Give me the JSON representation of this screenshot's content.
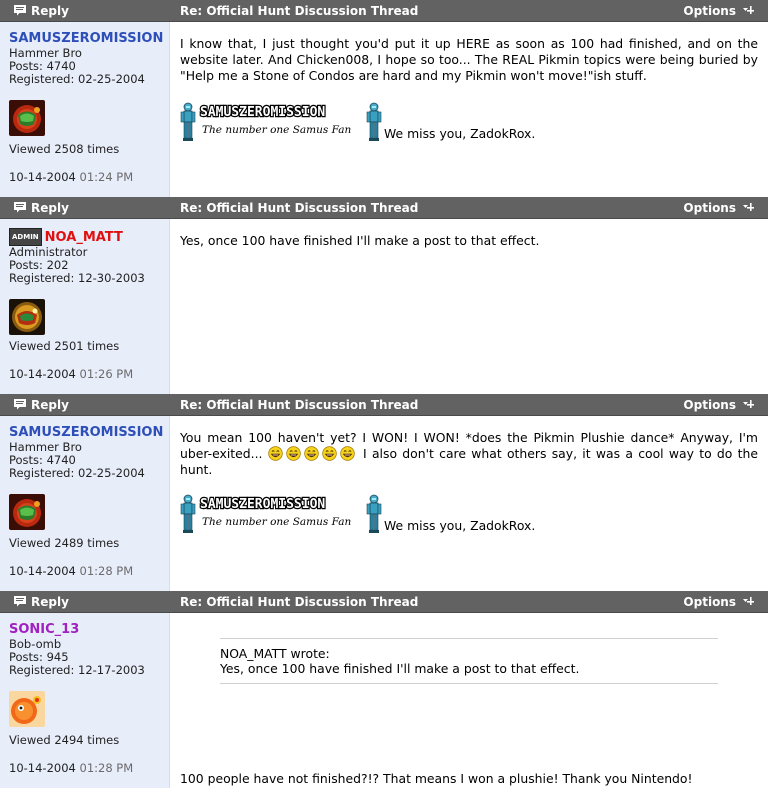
{
  "colors": {
    "bar_bg": "#626262",
    "user_bg": "#e8edfa",
    "username": "#2e4fb8",
    "admin_name": "#e01010",
    "sonic_name": "#a020c0",
    "time": "#6b6b6b"
  },
  "icons": {
    "reply": "reply-icon",
    "options": "options-icon",
    "smiley": "laughing-smiley-icon"
  },
  "posts": [
    {
      "reply_label": "Reply",
      "title": "Re: Official Hunt Discussion Thread",
      "options_label": "Options",
      "user": {
        "name": "SAMUSZEROMISSION",
        "rank": "Hammer Bro",
        "posts": "Posts: 4740",
        "registered": "Registered: 02-25-2004",
        "viewed": "Viewed 2508 times"
      },
      "date": "10-14-2004",
      "time": "01:24 PM",
      "body": "I know that, I just thought you'd put it up HERE as soon as 100 had finished, and on the website later. And Chicken008, I hope so too... The REAL Pikmin topics were being buried by \"Help me a Stone of Condos are hard and my Pikmin won't move!\"ish stuff.",
      "signature_banner": "SAMUSZEROMISSION",
      "signature_tagline": "The number one Samus Fan",
      "signature_text": "We miss you, ZadokRox."
    },
    {
      "reply_label": "Reply",
      "title": "Re: Official Hunt Discussion Thread",
      "options_label": "Options",
      "user": {
        "badge": "ADMIN",
        "name": "NOA_MATT",
        "rank": "Administrator",
        "posts": "Posts: 202",
        "registered": "Registered: 12-30-2003",
        "viewed": "Viewed 2501 times"
      },
      "date": "10-14-2004",
      "time": "01:26 PM",
      "body": "Yes, once 100 have finished I'll make a post to that effect."
    },
    {
      "reply_label": "Reply",
      "title": "Re: Official Hunt Discussion Thread",
      "options_label": "Options",
      "user": {
        "name": "SAMUSZEROMISSION",
        "rank": "Hammer Bro",
        "posts": "Posts: 4740",
        "registered": "Registered: 02-25-2004",
        "viewed": "Viewed 2489 times"
      },
      "date": "10-14-2004",
      "time": "01:28 PM",
      "body_part1": "You mean 100 haven't yet? I WON! I WON! *does the Pikmin Plushie dance* Anyway, I'm uber-exited...",
      "body_part2": "I also don't care what others say, it was a cool way to do the hunt.",
      "signature_banner": "SAMUSZEROMISSION",
      "signature_tagline": "The number one Samus Fan",
      "signature_text": "We miss you, ZadokRox."
    },
    {
      "reply_label": "Reply",
      "title": "Re: Official Hunt Discussion Thread",
      "options_label": "Options",
      "user": {
        "name": "SONIC_13",
        "rank": "Bob-omb",
        "posts": "Posts: 945",
        "registered": "Registered: 12-17-2003",
        "viewed": "Viewed 2494 times"
      },
      "date": "10-14-2004",
      "time": "01:28 PM",
      "quote_author": "NOA_MATT wrote:",
      "quote_text": "Yes, once 100 have finished I'll make a post to that effect.",
      "body": "100 people have not finished?!? That means I won a plushie! Thank you Nintendo!"
    }
  ]
}
